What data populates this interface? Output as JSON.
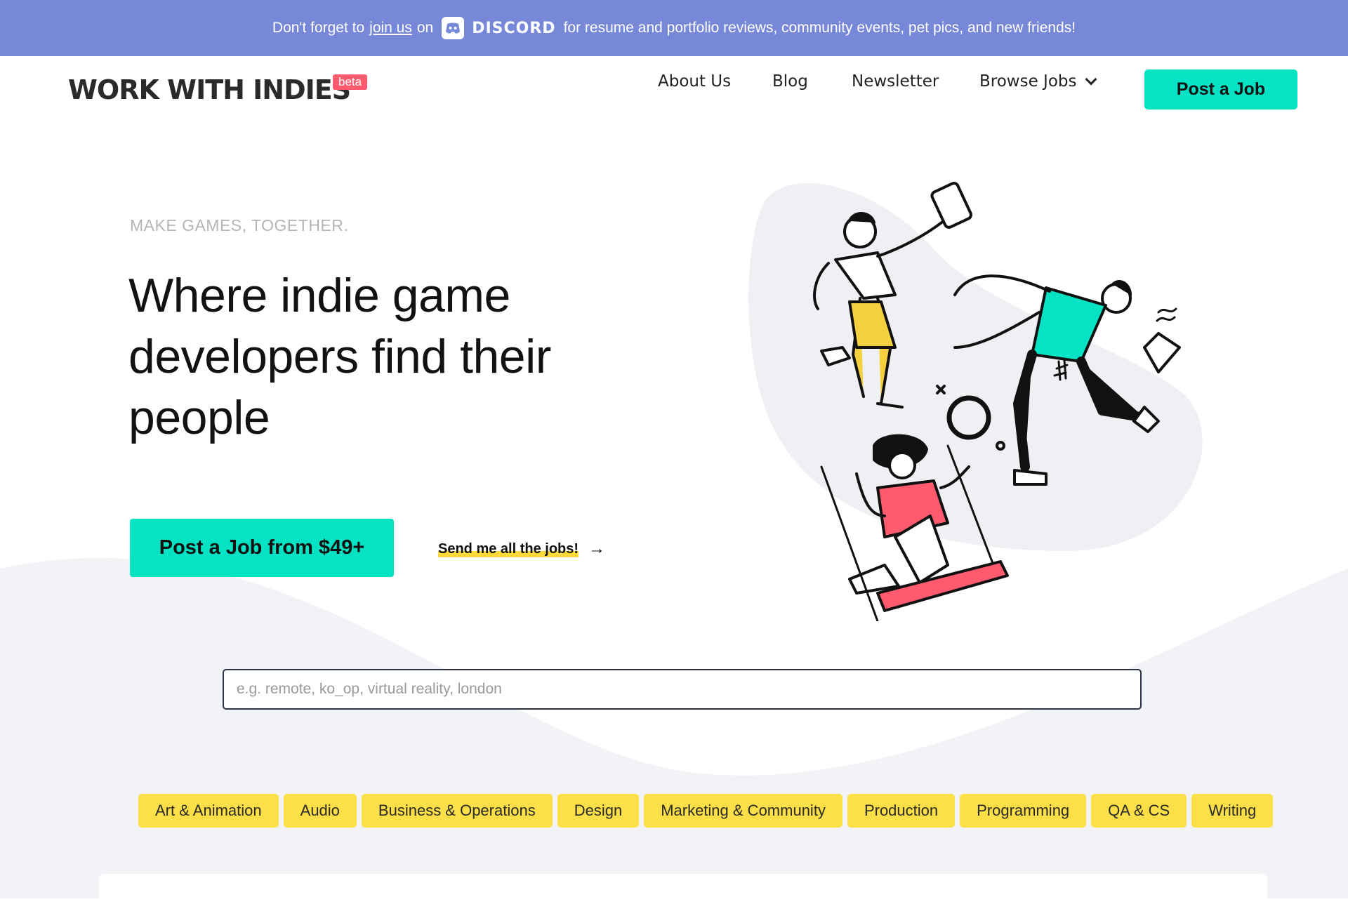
{
  "banner": {
    "prefix": "Don't forget to",
    "link": "join us",
    "on": "on",
    "discord_word": "DISCORD",
    "suffix": "for resume and portfolio reviews, community events, pet pics, and new friends!",
    "bg_color": "#7788d8"
  },
  "header": {
    "logo": "WORK WITH INDIES",
    "beta": "beta",
    "nav": {
      "about": "About Us",
      "blog": "Blog",
      "newsletter": "Newsletter",
      "browse": "Browse Jobs"
    },
    "post_job": "Post a Job"
  },
  "hero": {
    "eyebrow": "MAKE GAMES, TOGETHER.",
    "headline": "Where indie game developers find their people",
    "cta": "Post a Job from $49+",
    "send_link": "Send me all the jobs!",
    "arrow": "→"
  },
  "search": {
    "placeholder": "e.g. remote, ko_op, virtual reality, london",
    "value": ""
  },
  "categories": [
    "Art & Animation",
    "Audio",
    "Business & Operations",
    "Design",
    "Marketing & Community",
    "Production",
    "Programming",
    "QA & CS",
    "Writing"
  ],
  "colors": {
    "accent": "#06e3c4",
    "category": "#fde047",
    "beta": "#ff5a6e",
    "background_wave": "#f2f3f6"
  }
}
